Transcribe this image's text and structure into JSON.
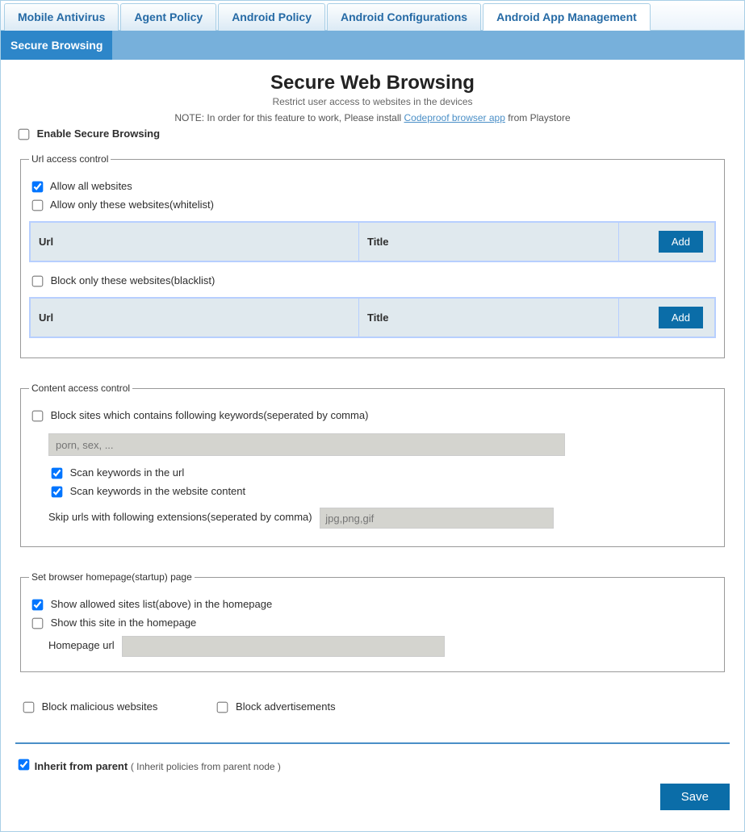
{
  "tabs": {
    "top": [
      {
        "label": "Mobile Antivirus",
        "active": false
      },
      {
        "label": "Agent Policy",
        "active": false
      },
      {
        "label": "Android Policy",
        "active": false
      },
      {
        "label": "Android Configurations",
        "active": false
      },
      {
        "label": "Android App Management",
        "active": true
      }
    ],
    "sub": [
      {
        "label": "Secure Browsing",
        "active": true
      }
    ]
  },
  "header": {
    "title": "Secure Web Browsing",
    "subtitle": "Restrict user access to websites in the devices",
    "note_prefix": "NOTE: In order for this feature to work, Please install ",
    "note_link": "Codeproof browser app",
    "note_suffix": " from Playstore"
  },
  "enable": {
    "label": "Enable Secure Browsing",
    "checked": false
  },
  "url_access": {
    "legend": "Url access control",
    "allow_all": {
      "label": "Allow all websites",
      "checked": true
    },
    "allow_only": {
      "label": "Allow only these websites(whitelist)",
      "checked": false
    },
    "block_only": {
      "label": "Block only these websites(blacklist)",
      "checked": false
    },
    "cols": {
      "url": "Url",
      "title": "Title"
    },
    "add": "Add"
  },
  "content_access": {
    "legend": "Content access control",
    "block_keywords": {
      "label": "Block sites which contains following keywords(seperated by comma)",
      "checked": false
    },
    "keywords_placeholder": "porn, sex, ...",
    "scan_url": {
      "label": "Scan keywords in the url",
      "checked": true
    },
    "scan_content": {
      "label": "Scan keywords in the website content",
      "checked": true
    },
    "skip_ext_label": "Skip urls with following extensions(seperated by comma)",
    "skip_ext_placeholder": "jpg,png,gif"
  },
  "homepage": {
    "legend": "Set browser homepage(startup) page",
    "show_allowed": {
      "label": "Show allowed sites list(above) in the homepage",
      "checked": true
    },
    "show_site": {
      "label": "Show this site in the homepage",
      "checked": false
    },
    "url_label": "Homepage url",
    "url_value": ""
  },
  "misc": {
    "block_malicious": {
      "label": "Block malicious websites",
      "checked": false
    },
    "block_ads": {
      "label": "Block advertisements",
      "checked": false
    }
  },
  "footer": {
    "inherit_label": "Inherit from parent",
    "inherit_note": "( Inherit policies from parent node )",
    "inherit_checked": true,
    "save": "Save"
  }
}
